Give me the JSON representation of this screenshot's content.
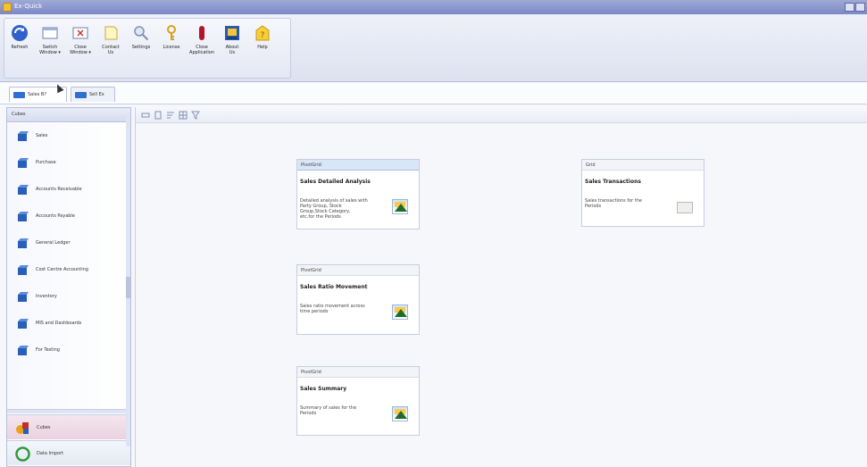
{
  "window": {
    "title": "Ex-Quick"
  },
  "ribbon": {
    "buttons": [
      {
        "label": "Refresh",
        "icon": "refresh-icon"
      },
      {
        "label": "Switch\nWindow ▾",
        "icon": "switch-window-icon"
      },
      {
        "label": "Close\nWindow ▾",
        "icon": "close-window-icon"
      },
      {
        "label": "Contact\nUs",
        "icon": "contact-icon"
      },
      {
        "label": "Settings",
        "icon": "settings-icon"
      },
      {
        "label": "License",
        "icon": "license-icon"
      },
      {
        "label": "Close\nApplication",
        "icon": "close-application-icon"
      },
      {
        "label": "About\nUs",
        "icon": "about-icon"
      },
      {
        "label": "Help",
        "icon": "help-icon"
      }
    ]
  },
  "tabs": [
    {
      "label": "Sales B?",
      "icon": "report-tab-icon",
      "active": true
    },
    {
      "label": "Sell Ex",
      "icon": "report-tab-icon",
      "active": false
    }
  ],
  "sidebar": {
    "header": "Cubes",
    "items": [
      {
        "label": "Sales"
      },
      {
        "label": "Purchase"
      },
      {
        "label": "Accounts Receivable"
      },
      {
        "label": "Accounts Payable"
      },
      {
        "label": "General Ledger"
      },
      {
        "label": "Cost Centre Accounting"
      },
      {
        "label": "Inventory"
      },
      {
        "label": "MIS and Dashboards"
      },
      {
        "label": "For Testing"
      }
    ],
    "bottom": [
      {
        "label": "Cubes",
        "active": true
      },
      {
        "label": "Data Import",
        "active": false
      }
    ]
  },
  "cards": [
    {
      "type": "PivotGrid",
      "title": "Sales Detailed Analysis",
      "desc": "Detailed analysis of sales with\nParty Group, Stock\nGroup,Stock Category,\netc.for the Periods",
      "icon": "pivot-chart-icon"
    },
    {
      "type": "Grid",
      "title": "Sales Transactions",
      "desc": "Sales transactions for the\nPeriods",
      "icon": "grid-icon"
    },
    {
      "type": "PivotGrid",
      "title": "Sales Ratio Movement",
      "desc": "Sales ratio movement across\ntime periods",
      "icon": "pivot-chart-icon"
    },
    {
      "type": "PivotGrid",
      "title": "Sales Summary",
      "desc": "Summary of sales for the\nPeriods",
      "icon": "pivot-chart-icon"
    }
  ],
  "colors": {
    "titlebar": "#8a95cc",
    "accent": "#2f6fd1",
    "sidebar_active": "#ead6e2"
  }
}
